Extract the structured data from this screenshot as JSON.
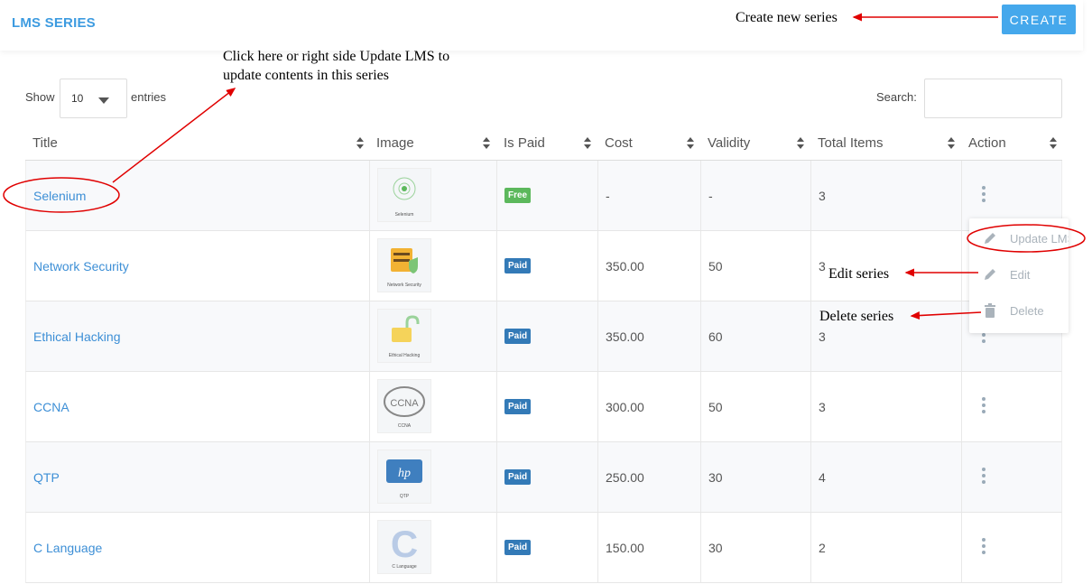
{
  "header": {
    "title": "LMS SERIES",
    "create_label": "CREATE"
  },
  "controls": {
    "show_label": "Show",
    "page_size": "10",
    "entries_label": "entries",
    "search_label": "Search:",
    "search_value": ""
  },
  "columns": [
    "Title",
    "Image",
    "Is Paid",
    "Cost",
    "Validity",
    "Total Items",
    "Action"
  ],
  "rows": [
    {
      "title": "Selenium",
      "image_caption": "Selenium",
      "badge": "Free",
      "cost": "-",
      "validity": "-",
      "total_items": "3"
    },
    {
      "title": "Network Security",
      "image_caption": "Network Security",
      "badge": "Paid",
      "cost": "350.00",
      "validity": "50",
      "total_items": "3"
    },
    {
      "title": "Ethical Hacking",
      "image_caption": "Ethical Hacking",
      "badge": "Paid",
      "cost": "350.00",
      "validity": "60",
      "total_items": "3"
    },
    {
      "title": "CCNA",
      "image_caption": "CCNA",
      "badge": "Paid",
      "cost": "300.00",
      "validity": "50",
      "total_items": "3"
    },
    {
      "title": "QTP",
      "image_caption": "QTP",
      "badge": "Paid",
      "cost": "250.00",
      "validity": "30",
      "total_items": "4"
    },
    {
      "title": "C Language",
      "image_caption": "C Language",
      "badge": "Paid",
      "cost": "150.00",
      "validity": "30",
      "total_items": "2"
    }
  ],
  "action_menu": {
    "update": "Update LMS",
    "edit": "Edit",
    "delete": "Delete"
  },
  "annotations": {
    "create": "Create new series",
    "click_line1": "Click here or right side Update LMS to",
    "click_line2": "update contents in this series",
    "edit": "Edit series",
    "delete": "Delete series"
  },
  "colors": {
    "accent": "#3d9be0",
    "create_button": "#45a8ec",
    "free_badge": "#5cb85c",
    "paid_badge": "#337ab7",
    "annotation": "#e00000"
  }
}
